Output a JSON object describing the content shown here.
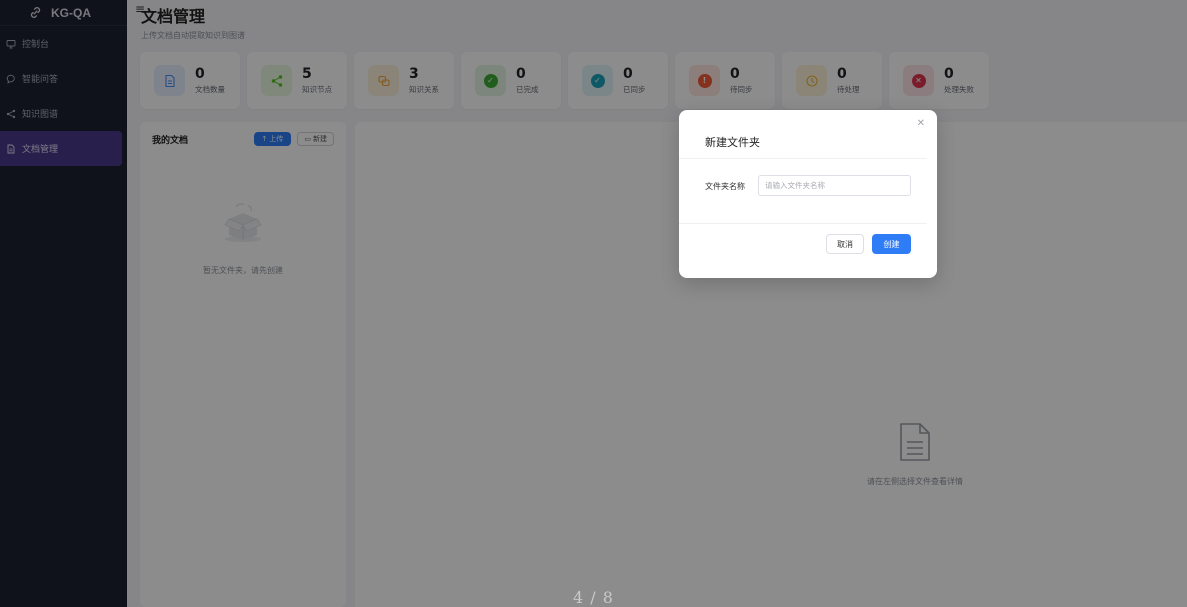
{
  "app": {
    "name": "KG-QA"
  },
  "sidebar": {
    "items": [
      {
        "label": "控制台",
        "icon": "monitor-icon",
        "active": false
      },
      {
        "label": "智能问答",
        "icon": "chat-bubble-icon",
        "active": false
      },
      {
        "label": "知识图谱",
        "icon": "share-icon",
        "active": false
      },
      {
        "label": "文档管理",
        "icon": "document-icon",
        "active": true
      }
    ]
  },
  "header": {
    "title": "文档管理",
    "subtitle": "上传文档自动提取知识到图谱"
  },
  "stats": [
    {
      "value": "0",
      "label": "文档数量",
      "icon": "document-icon",
      "color": "#4a8cf7",
      "bg": "#e7efff"
    },
    {
      "value": "5",
      "label": "知识节点",
      "icon": "share-icon",
      "color": "#52c41a",
      "bg": "#e9f7e1"
    },
    {
      "value": "3",
      "label": "知识关系",
      "icon": "link-icon",
      "color": "#f0a83c",
      "bg": "#fdf0dc"
    },
    {
      "value": "0",
      "label": "已完成",
      "icon": "check-circle-icon",
      "color": "#3dab37",
      "bg": "#e3f5e2"
    },
    {
      "value": "0",
      "label": "已同步",
      "icon": "check-circle-icon",
      "color": "#1aa3b8",
      "bg": "#dff4f7"
    },
    {
      "value": "0",
      "label": "待同步",
      "icon": "exclamation-circle-icon",
      "color": "#f25a36",
      "bg": "#fde6e1"
    },
    {
      "value": "0",
      "label": "待处理",
      "icon": "clock-icon",
      "color": "#e8b53a",
      "bg": "#fdf3d9"
    },
    {
      "value": "0",
      "label": "处理失败",
      "icon": "close-circle-icon",
      "color": "#e0334f",
      "bg": "#fde3e7"
    }
  ],
  "docs": {
    "title": "我的文档",
    "upload_label": "上传",
    "new_label": "新建",
    "empty_text": "暂无文件夹，请先创建"
  },
  "detail": {
    "empty_text": "请在左侧选择文件查看详情"
  },
  "modal": {
    "title": "新建文件夹",
    "field_label": "文件夹名称",
    "input_value": "",
    "input_placeholder": "请输入文件夹名称",
    "cancel_label": "取消",
    "create_label": "创建"
  },
  "pager": {
    "text": "4 / 8"
  }
}
